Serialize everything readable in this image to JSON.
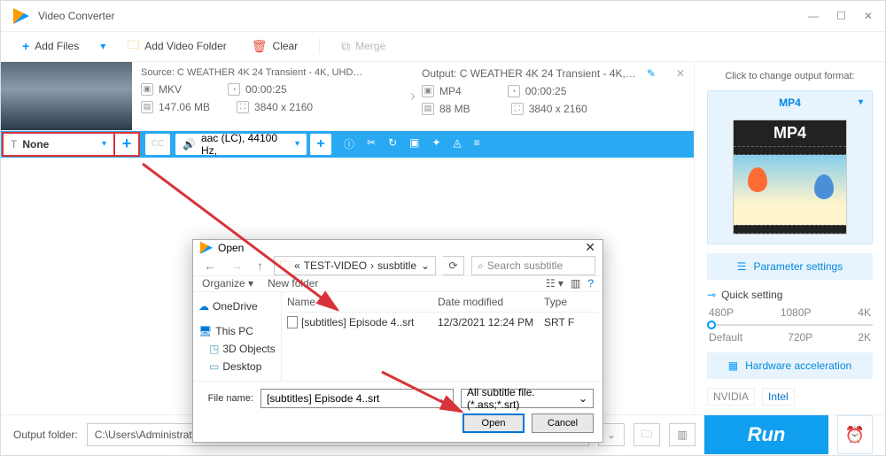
{
  "title": "Video Converter",
  "toolbar": {
    "add_files": "Add Files",
    "add_folder": "Add Video Folder",
    "clear": "Clear",
    "merge": "Merge"
  },
  "item": {
    "source_label": "Source: C  WEATHER  4K 24  Transient - 4K, UHD…",
    "src_format": "MKV",
    "src_duration": "00:00:25",
    "src_size": "147.06 MB",
    "src_res": "3840 x 2160",
    "output_label": "Output: C  WEATHER  4K 24  Transient - 4K,…",
    "out_format": "MP4",
    "out_duration": "00:00:25",
    "out_size": "88 MB",
    "out_res": "3840 x 2160"
  },
  "subbar": {
    "subtitle_value": "None",
    "cc": "CC",
    "audio_value": "aac (LC), 44100 Hz,"
  },
  "side": {
    "hint": "Click to change output format:",
    "format": "MP4",
    "format_badge": "MP4",
    "param_btn": "Parameter settings",
    "quick_label": "Quick setting",
    "qs_top": [
      "480P",
      "1080P",
      "4K"
    ],
    "qs_bottom": [
      "Default",
      "720P",
      "2K"
    ],
    "hw_btn": "Hardware acceleration",
    "hw_logos": [
      "NVIDIA",
      "Intel"
    ]
  },
  "bottom": {
    "label": "Output folder:",
    "path": "C:\\Users\\Administrator\\Desktop\\video-audio",
    "run": "Run"
  },
  "dialog": {
    "title": "Open",
    "breadcrumb": [
      "TEST-VIDEO",
      "susbtitle"
    ],
    "search_placeholder": "Search susbtitle",
    "organize": "Organize",
    "newfolder": "New folder",
    "tree": [
      "OneDrive",
      "This PC",
      "3D Objects",
      "Desktop"
    ],
    "cols": [
      "Name",
      "Date modified",
      "Type"
    ],
    "row": {
      "name": "[subtitles] Episode 4..srt",
      "date": "12/3/2021 12:24 PM",
      "type": "SRT F"
    },
    "fn_label": "File name:",
    "fn_value": "[subtitles] Episode 4..srt",
    "filter": "All subtitle file. (*.ass;*.srt)",
    "open": "Open",
    "cancel": "Cancel"
  }
}
